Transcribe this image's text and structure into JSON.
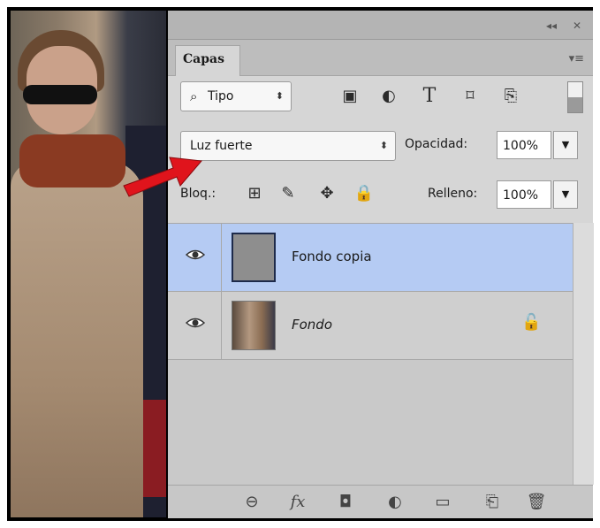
{
  "panel": {
    "tab_label": "Capas",
    "collapse_icon": "double-chevron-left-icon",
    "close_icon": "close-icon",
    "menu_icon": "panel-menu-icon"
  },
  "filter": {
    "kind_label": "Tipo",
    "icons": [
      "image-filter-icon",
      "adjustment-filter-icon",
      "type-filter-icon",
      "shape-filter-icon",
      "smart-object-filter-icon"
    ]
  },
  "blend": {
    "mode_value": "Luz fuerte",
    "opacity_label": "Opacidad:",
    "opacity_value": "100%"
  },
  "lock": {
    "label": "Bloq.:",
    "fill_label": "Relleno:",
    "fill_value": "100%"
  },
  "layers": [
    {
      "name": "Fondo copia",
      "selected": true,
      "visible": true
    },
    {
      "name": "Fondo",
      "selected": false,
      "visible": true,
      "locked": true
    }
  ],
  "footer_icons": [
    "link-icon",
    "fx-icon",
    "mask-icon",
    "adjustment-icon",
    "folder-icon",
    "new-layer-icon",
    "trash-icon"
  ],
  "colors": {
    "selection": "#b5cbf3",
    "panel": "#d6d6d6",
    "arrow": "#e0141c"
  }
}
